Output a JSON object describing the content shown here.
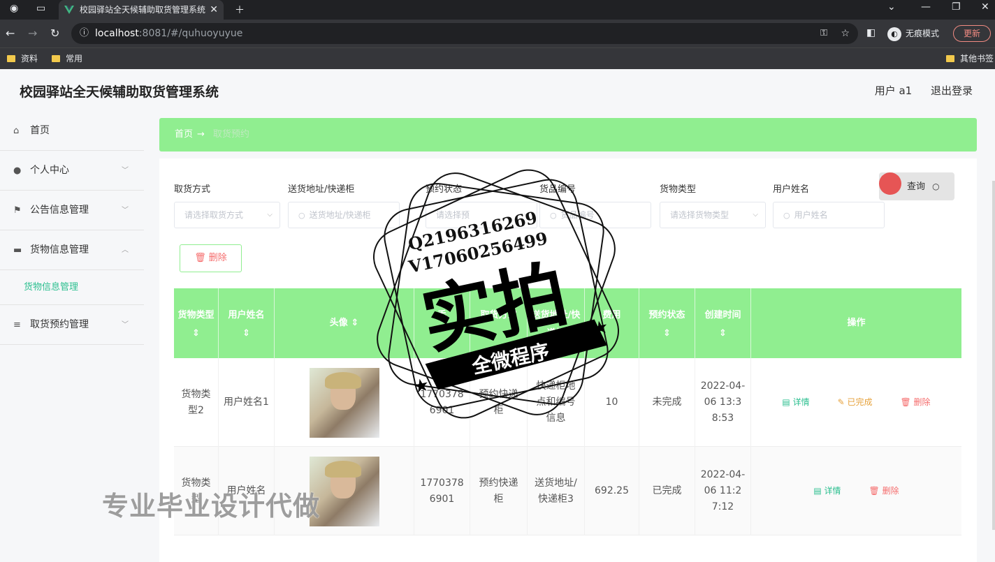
{
  "browser": {
    "tab_title": "校园驿站全天候辅助取货管理系统",
    "url_host": "localhost",
    "url_path": ":8081/#/quhuoyuyue",
    "incognito_label": "无痕模式",
    "update_label": "更新",
    "bookmarks": [
      "资料",
      "常用"
    ],
    "other_bookmarks": "其他书签"
  },
  "app": {
    "title": "校园驿站全天候辅助取货管理系统",
    "user_label": "用户 a1",
    "logout_label": "退出登录"
  },
  "sidebar": {
    "items": [
      {
        "label": "首页",
        "icon": "home-icon"
      },
      {
        "label": "个人中心",
        "icon": "user-icon"
      },
      {
        "label": "公告信息管理",
        "icon": "flag-icon"
      },
      {
        "label": "货物信息管理",
        "icon": "ticket-icon"
      },
      {
        "label": "取货预约管理",
        "icon": "list-icon"
      }
    ],
    "sub_item": "货物信息管理"
  },
  "breadcrumb": {
    "home": "首页",
    "arrow": "→",
    "current": "取货预约"
  },
  "filters": [
    {
      "label": "取货方式",
      "placeholder": "请选择取货方式",
      "kind": "select"
    },
    {
      "label": "送货地址/快递柜",
      "placeholder": "送货地址/快递柜",
      "kind": "search"
    },
    {
      "label": "预约状态",
      "placeholder": "请选择预",
      "kind": "select"
    },
    {
      "label": "货品编号",
      "placeholder": "货品编号",
      "kind": "search"
    },
    {
      "label": "货物类型",
      "placeholder": "请选择货物类型",
      "kind": "select"
    },
    {
      "label": "用户姓名",
      "placeholder": "用户姓名",
      "kind": "search"
    }
  ],
  "query_label": "查询",
  "delete_label": "删除",
  "table": {
    "headers": [
      {
        "label": "货物类型",
        "sort": "⇕"
      },
      {
        "label": "用户姓名",
        "sort": "⇕"
      },
      {
        "label": "头像",
        "sort": "⇕"
      },
      {
        "label": "手",
        "sort": ""
      },
      {
        "label": "取货方式",
        "sort": ""
      },
      {
        "label": "送货地址/快递柜",
        "sort": ""
      },
      {
        "label": "费用",
        "sort": ""
      },
      {
        "label": "预约状态",
        "sort": "⇕"
      },
      {
        "label": "创建时间",
        "sort": "⇕"
      },
      {
        "label": "操作",
        "sort": ""
      }
    ],
    "rows": [
      {
        "type": "货物类型2",
        "user": "用户姓名1",
        "phone": "17703786901",
        "method": "预约快递柜",
        "address": "快递柜地点和编号信息",
        "fee": "10",
        "status": "未完成",
        "created": "2022-04-06 13:38:53",
        "ops": [
          "详情",
          "已完成",
          "删除"
        ]
      },
      {
        "type": "货物类型",
        "user": "用户姓名",
        "phone": "17703786901",
        "method": "预约快递柜",
        "address": "送货地址/快递柜3",
        "fee": "692.25",
        "status": "已完成",
        "created": "2022-04-06 11:27:12",
        "ops": [
          "详情",
          "删除"
        ]
      }
    ]
  },
  "watermark": {
    "bottom_text": "专业毕业设计代做",
    "stamp_line1": "Q2196316269",
    "stamp_line2": "V17060256499",
    "stamp_big": "实拍",
    "stamp_banner": "全微程序"
  }
}
